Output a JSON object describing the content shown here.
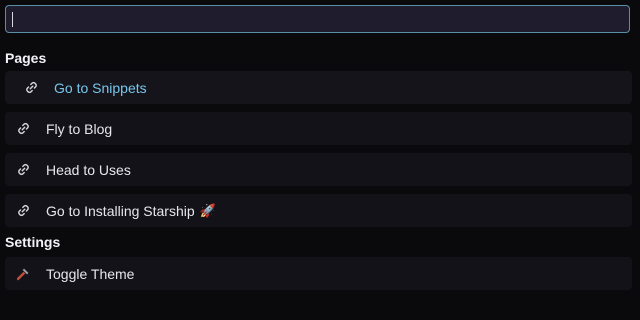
{
  "search": {
    "value": "",
    "placeholder": ""
  },
  "sections": {
    "pages_title": "Pages",
    "settings_title": "Settings"
  },
  "pages": [
    {
      "label": "Go to Snippets",
      "icon": "link-icon",
      "active": true
    },
    {
      "label": "Fly to Blog",
      "icon": "link-icon",
      "active": false
    },
    {
      "label": "Head to Uses",
      "icon": "link-icon",
      "active": false
    },
    {
      "label": "Go to Installing Starship",
      "icon": "link-icon",
      "suffix": "🚀",
      "active": false
    }
  ],
  "settings": [
    {
      "label": "Toggle Theme",
      "icon": "hammer-icon",
      "active": false
    }
  ],
  "colors": {
    "background": "#0a0a0c",
    "search_background": "#1f1c2d",
    "search_border": "#5a8fa8",
    "item_background": "#131218",
    "active_label": "#78c6ee"
  }
}
